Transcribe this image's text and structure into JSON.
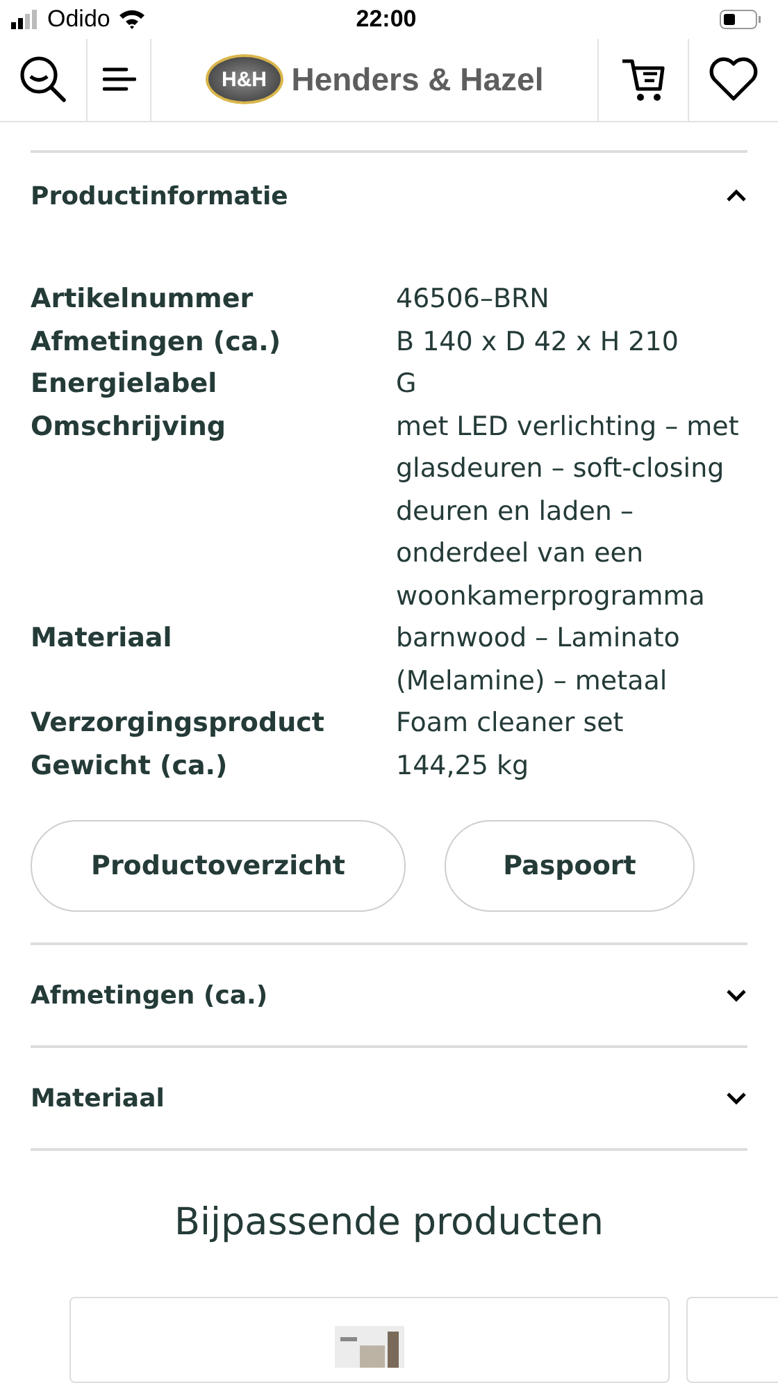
{
  "status_bar": {
    "carrier": "Odido",
    "time": "22:00"
  },
  "header": {
    "brand_badge": "H&H",
    "brand_name": "Henders & Hazel"
  },
  "sections": [
    {
      "title": "Productinformatie",
      "expanded": true,
      "specs": [
        {
          "label": "Artikelnummer",
          "value": "46506–BRN"
        },
        {
          "label": "Afmetingen (ca.)",
          "value": "B 140 x D 42 x H 210"
        },
        {
          "label": "Energielabel",
          "value": "G"
        },
        {
          "label": "Omschrijving",
          "value": "met LED verlichting – met glasdeuren – soft-closing deuren en laden – onderdeel van een woonkamerprogramma"
        },
        {
          "label": "Materiaal",
          "value": "barnwood – Laminato (Melamine) – metaal"
        },
        {
          "label": "Verzorgingsproduct",
          "value": "Foam cleaner set"
        },
        {
          "label": "Gewicht (ca.)",
          "value": "144,25 kg"
        }
      ],
      "buttons": [
        "Productoverzicht",
        "Paspoort"
      ]
    },
    {
      "title": "Afmetingen (ca.)",
      "expanded": false
    },
    {
      "title": "Materiaal",
      "expanded": false
    }
  ],
  "related": {
    "title": "Bijpassende producten",
    "cards": [
      {
        "kind": "picture"
      },
      {
        "kind": "empty"
      }
    ]
  }
}
